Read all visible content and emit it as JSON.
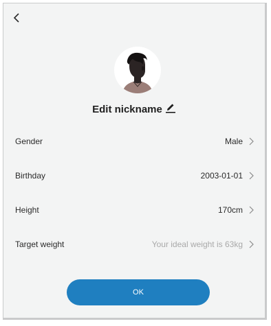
{
  "header": {
    "back_icon": "chevron-left-icon"
  },
  "profile": {
    "avatar_icon": "male-avatar-illustration",
    "nickname_label": "Edit nickname",
    "edit_icon": "pencil-icon"
  },
  "fields": [
    {
      "label": "Gender",
      "value": "Male",
      "placeholder": false
    },
    {
      "label": "Birthday",
      "value": "2003-01-01",
      "placeholder": false
    },
    {
      "label": "Height",
      "value": "170cm",
      "placeholder": false
    },
    {
      "label": "Target weight",
      "value": "Your ideal weight is 63kg",
      "placeholder": true
    }
  ],
  "ok_button": {
    "label": "OK",
    "color": "#1f7fc0"
  },
  "colors": {
    "background": "#f3f4f4",
    "accent": "#1f7fc0",
    "text": "#2a2a2a",
    "placeholder": "#a9a9a9"
  }
}
